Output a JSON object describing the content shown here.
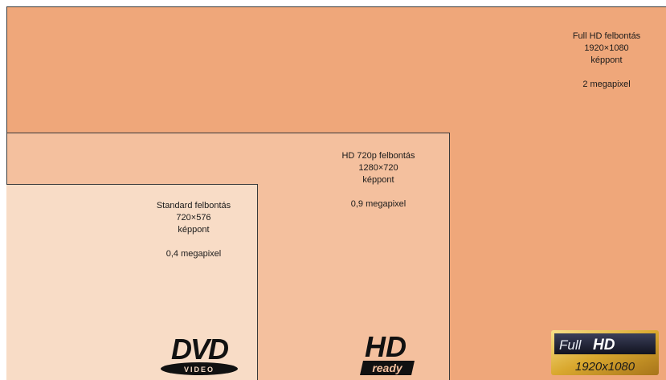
{
  "fullhd": {
    "title": "Full HD felbontás",
    "resolution": "1920×1080",
    "unit": "képpont",
    "megapixel": "2 megapixel",
    "logo": {
      "line1_a": "Full",
      "line1_b": "HD",
      "line2": "1920x1080"
    }
  },
  "hd720": {
    "title": "HD 720p felbontás",
    "resolution": "1280×720",
    "unit": "képpont",
    "megapixel": "0,9 megapixel",
    "logo": {
      "top": "HD",
      "bottom": "ready"
    }
  },
  "standard": {
    "title": "Standard felbontás",
    "resolution": "720×576",
    "unit": "képpont",
    "megapixel": "0,4 megapixel",
    "logo": {
      "top": "DVD",
      "bottom": "VIDEO"
    }
  },
  "colors": {
    "fullhd_bg": "#efa77a",
    "hd720_bg": "#f4c09e",
    "standard_bg": "#f8dcc6",
    "border": "#3a3a3a"
  }
}
